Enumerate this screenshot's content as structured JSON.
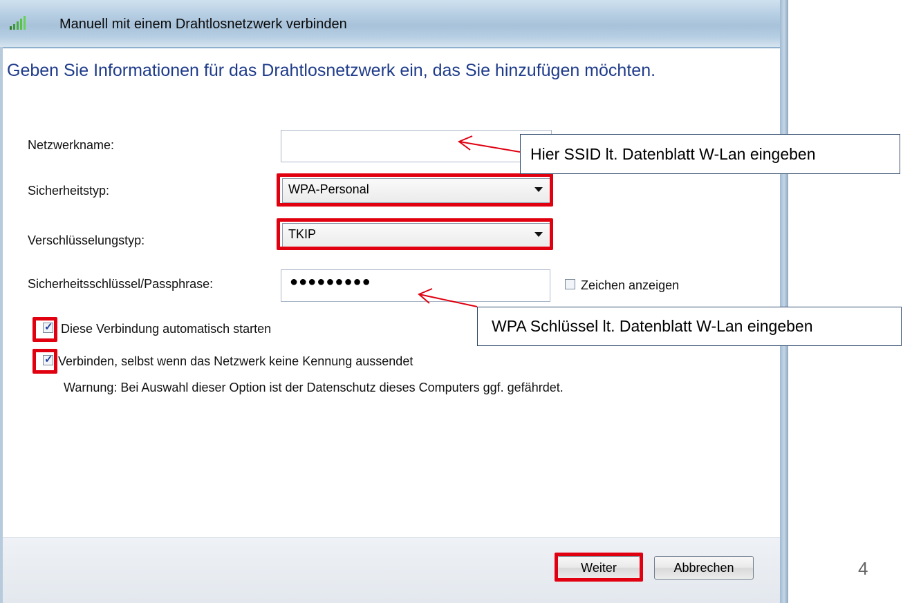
{
  "window": {
    "title": "Manuell mit einem Drahtlosnetzwerk verbinden",
    "icon": "wifi-signal-icon"
  },
  "main": {
    "heading": "Geben Sie Informationen für das Drahtlosnetzwerk ein, das Sie hinzufügen möchten."
  },
  "form": {
    "network_name_label": "Netzwerkname:",
    "network_name_value": "",
    "security_type_label": "Sicherheitstyp:",
    "security_type_value": "WPA-Personal",
    "encryption_type_label": "Verschlüsselungstyp:",
    "encryption_type_value": "TKIP",
    "security_key_label": "Sicherheitsschlüssel/Passphrase:",
    "security_key_value": "●●●●●●●●●",
    "show_characters_label": "Zeichen anzeigen",
    "show_characters_checked": false,
    "auto_start_label": "Diese Verbindung automatisch starten",
    "auto_start_checked": true,
    "connect_hidden_label": "Verbinden, selbst wenn das Netzwerk keine Kennung aussendet",
    "connect_hidden_checked": true,
    "warning_text": "Warnung: Bei Auswahl dieser Option ist der Datenschutz dieses Computers ggf. gefährdet."
  },
  "footer": {
    "next_label": "Weiter",
    "cancel_label": "Abbrechen"
  },
  "annotations": {
    "ssid_callout": "Hier SSID lt. Datenblatt W-Lan eingeben",
    "wpa_callout": "WPA Schlüssel lt. Datenblatt W-Lan eingeben",
    "highlight_color": "#e00010",
    "arrow_color": "#e00010"
  },
  "slide": {
    "page_number": "4"
  }
}
